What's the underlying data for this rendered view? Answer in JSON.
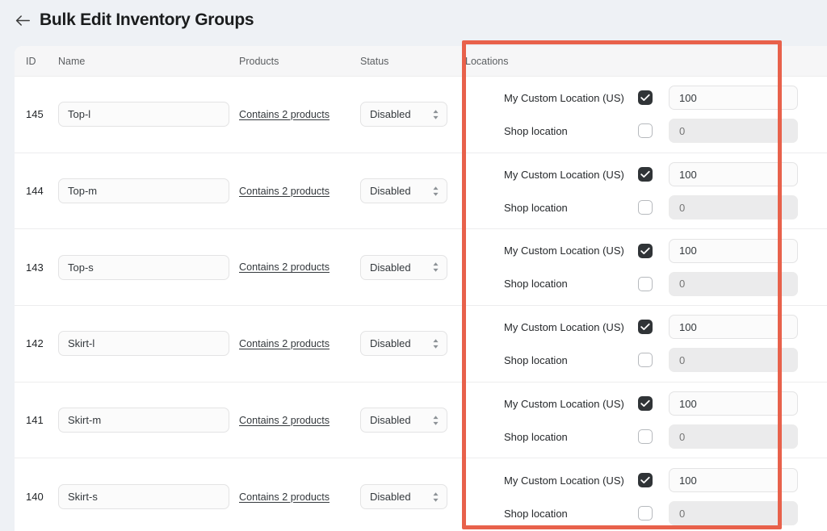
{
  "header": {
    "back_icon": "arrow-left-icon",
    "title": "Bulk Edit Inventory Groups"
  },
  "table": {
    "columns": {
      "id": "ID",
      "name": "Name",
      "products": "Products",
      "status": "Status",
      "locations": "Locations"
    },
    "rows": [
      {
        "id": "145",
        "name": "Top-l",
        "products_link": "Contains 2 products",
        "status": "Disabled",
        "locations": [
          {
            "label": "My Custom Location (US)",
            "checked": true,
            "qty": "100",
            "placeholder": "0"
          },
          {
            "label": "Shop location",
            "checked": false,
            "qty": "",
            "placeholder": "0"
          }
        ]
      },
      {
        "id": "144",
        "name": "Top-m",
        "products_link": "Contains 2 products",
        "status": "Disabled",
        "locations": [
          {
            "label": "My Custom Location (US)",
            "checked": true,
            "qty": "100",
            "placeholder": "0"
          },
          {
            "label": "Shop location",
            "checked": false,
            "qty": "",
            "placeholder": "0"
          }
        ]
      },
      {
        "id": "143",
        "name": "Top-s",
        "products_link": "Contains 2 products",
        "status": "Disabled",
        "locations": [
          {
            "label": "My Custom Location (US)",
            "checked": true,
            "qty": "100",
            "placeholder": "0"
          },
          {
            "label": "Shop location",
            "checked": false,
            "qty": "",
            "placeholder": "0"
          }
        ]
      },
      {
        "id": "142",
        "name": "Skirt-l",
        "products_link": "Contains 2 products",
        "status": "Disabled",
        "locations": [
          {
            "label": "My Custom Location (US)",
            "checked": true,
            "qty": "100",
            "placeholder": "0"
          },
          {
            "label": "Shop location",
            "checked": false,
            "qty": "",
            "placeholder": "0"
          }
        ]
      },
      {
        "id": "141",
        "name": "Skirt-m",
        "products_link": "Contains 2 products",
        "status": "Disabled",
        "locations": [
          {
            "label": "My Custom Location (US)",
            "checked": true,
            "qty": "100",
            "placeholder": "0"
          },
          {
            "label": "Shop location",
            "checked": false,
            "qty": "",
            "placeholder": "0"
          }
        ]
      },
      {
        "id": "140",
        "name": "Skirt-s",
        "products_link": "Contains 2 products",
        "status": "Disabled",
        "locations": [
          {
            "label": "My Custom Location (US)",
            "checked": true,
            "qty": "100",
            "placeholder": "0"
          },
          {
            "label": "Shop location",
            "checked": false,
            "qty": "",
            "placeholder": "0"
          }
        ]
      }
    ]
  },
  "annotation": {
    "highlight_color": "#e8614b",
    "target_column": "Locations"
  },
  "colors": {
    "page_background": "#eef1f5",
    "card_background": "#ffffff",
    "header_row_background": "#f6f6f7",
    "checkbox_checked": "#303437",
    "disabled_input_background": "#ebebec"
  }
}
